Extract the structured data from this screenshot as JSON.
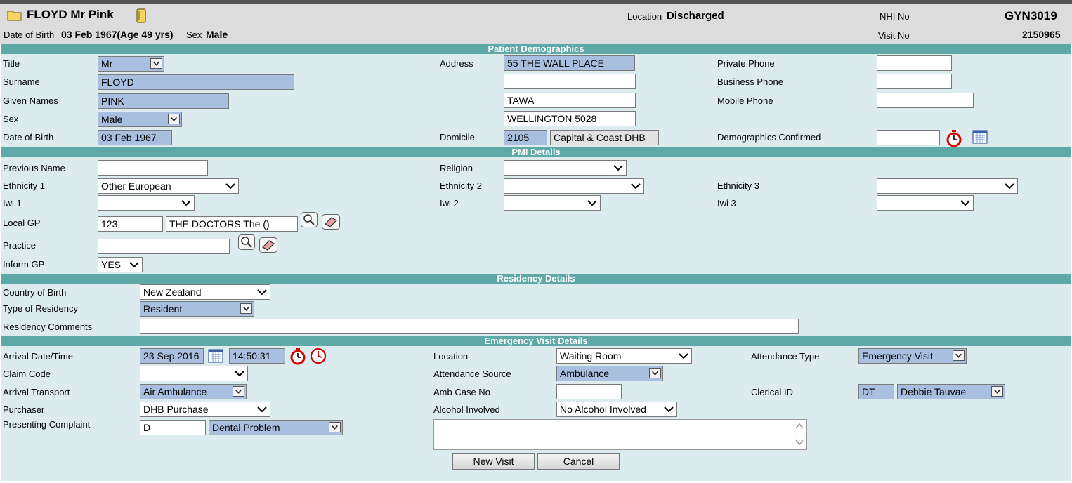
{
  "header": {
    "patient_name": "FLOYD Mr Pink",
    "location_label": "Location",
    "location_value": "Discharged",
    "nhi_label": "NHI No",
    "nhi_value": "GYN3019",
    "dob_label": "Date of Birth",
    "dob_value": "03 Feb 1967(Age 49 yrs)",
    "sex_label": "Sex",
    "sex_value": "Male",
    "visit_label": "Visit No",
    "visit_value": "2150965"
  },
  "sections": {
    "demographics": "Patient Demographics",
    "pmi": "PMI Details",
    "residency": "Residency Details",
    "emergency": "Emergency Visit Details"
  },
  "demographics": {
    "title_label": "Title",
    "title_value": "Mr",
    "surname_label": "Surname",
    "surname_value": "FLOYD",
    "given_label": "Given Names",
    "given_value": "PINK",
    "sex_label": "Sex",
    "sex_value": "Male",
    "dob_label": "Date of Birth",
    "dob_value": "03 Feb 1967",
    "address_label": "Address",
    "address_line1": "55 THE WALL PLACE",
    "address_line2": "",
    "address_line3": "TAWA",
    "address_line4": "WELLINGTON 5028",
    "domicile_label": "Domicile",
    "domicile_code": "2105",
    "domicile_name": "Capital & Coast DHB",
    "private_phone_label": "Private Phone",
    "private_phone_value": "",
    "business_phone_label": "Business Phone",
    "business_phone_value": "",
    "mobile_phone_label": "Mobile Phone",
    "mobile_phone_value": "",
    "confirmed_label": "Demographics Confirmed",
    "confirmed_value": ""
  },
  "pmi": {
    "prev_name_label": "Previous Name",
    "prev_name_value": "",
    "religion_label": "Religion",
    "religion_value": "",
    "eth1_label": "Ethnicity 1",
    "eth1_value": "Other European",
    "eth2_label": "Ethnicity 2",
    "eth2_value": "",
    "eth3_label": "Ethnicity 3",
    "eth3_value": "",
    "iwi1_label": "Iwi 1",
    "iwi1_value": "",
    "iwi2_label": "Iwi 2",
    "iwi2_value": "",
    "iwi3_label": "Iwi 3",
    "iwi3_value": "",
    "gp_label": "Local GP",
    "gp_code": "123",
    "gp_name": "THE DOCTORS The  ()",
    "practice_label": "Practice",
    "practice_value": "",
    "inform_label": "Inform GP",
    "inform_value": "YES"
  },
  "residency": {
    "country_label": "Country of Birth",
    "country_value": "New Zealand",
    "type_label": "Type of Residency",
    "type_value": "Resident",
    "comments_label": "Residency Comments",
    "comments_value": ""
  },
  "emergency": {
    "arrival_label": "Arrival Date/Time",
    "arrival_date": "23 Sep 2016",
    "arrival_time": "14:50:31",
    "claim_label": "Claim Code",
    "claim_value": "",
    "transport_label": "Arrival Transport",
    "transport_value": "Air Ambulance",
    "purchaser_label": "Purchaser",
    "purchaser_value": "DHB Purchase",
    "complaint_label": "Presenting Complaint",
    "complaint_code": "D",
    "complaint_value": "Dental Problem",
    "location_label": "Location",
    "location_value": "Waiting Room",
    "source_label": "Attendance Source",
    "source_value": "Ambulance",
    "amb_label": "Amb Case No",
    "amb_value": "",
    "alcohol_label": "Alcohol Involved",
    "alcohol_value": "No Alcohol Involved",
    "att_type_label": "Attendance Type",
    "att_type_value": "Emergency Visit",
    "clerical_label": "Clerical ID",
    "clerical_code": "DT",
    "clerical_name": "Debbie Tauvae",
    "notes_value": ""
  },
  "buttons": {
    "new_visit": "New Visit",
    "cancel": "Cancel"
  },
  "icons": [
    "folder-icon",
    "notebook-icon",
    "stopwatch-icon",
    "calendar-icon",
    "magnifier-icon",
    "eraser-icon",
    "clock-icon",
    "chevron-down-icon"
  ]
}
